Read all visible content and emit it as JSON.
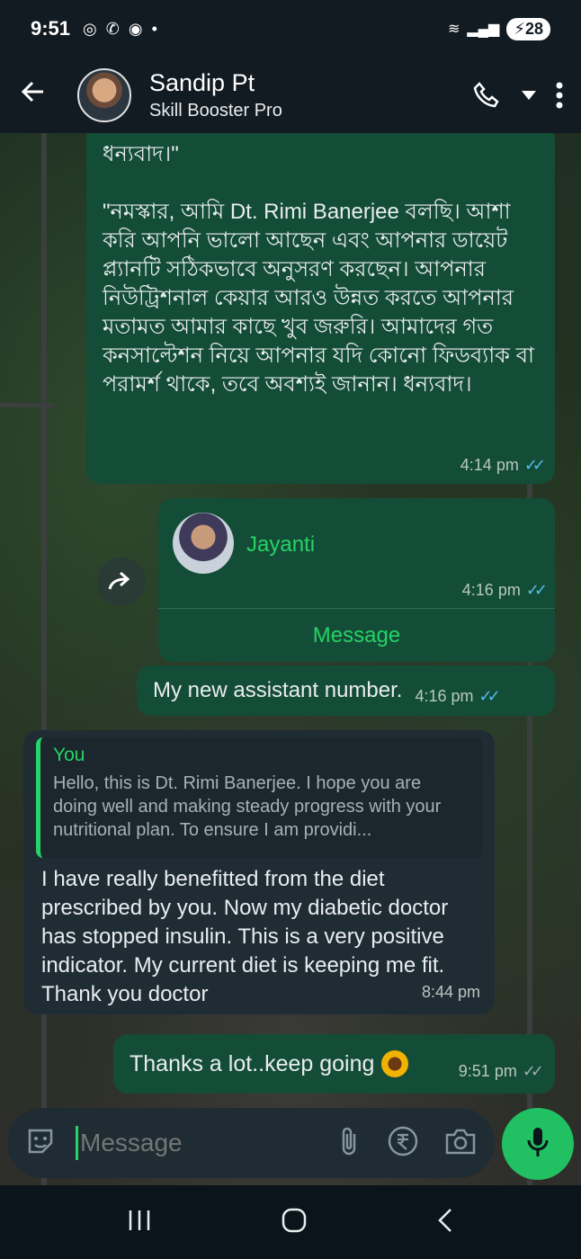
{
  "status_bar": {
    "time": "9:51",
    "battery": "28"
  },
  "header": {
    "contact_name": "Sandip Pt",
    "contact_status": "Skill Booster Pro"
  },
  "messages": [
    {
      "text": "ধন্যবাদ।\"\n\n\"নমস্কার, আমি Dt. Rimi Banerjee বলছি। আশা করি আপনি ভালো আছেন এবং আপনার ডায়েট প্ল্যানটি সঠিকভাবে অনুসরণ করছেন। আপনার নিউট্রিশনাল কেয়ার আরও উন্নত করতে আপনার মতামত আমার কাছে খুব জরুরি। আমাদের গত কনসাল্টেশন নিয়ে আপনার যদি কোনো ফিডব্যাক বা পরামর্শ থাকে, তবে অবশ্যই জানান। ধন্যবাদ।",
      "time": "4:14 pm"
    },
    {
      "contact_card_name": "Jayanti",
      "time": "4:16 pm",
      "button_label": "Message"
    },
    {
      "text": "My new assistant number.",
      "time": "4:16 pm"
    },
    {
      "quote_author": "You",
      "quote_text": "Hello, this is Dt. Rimi Banerjee. I hope you are doing well and making steady progress with your nutritional plan. To ensure I am providi...",
      "text": "I have really benefitted from the diet prescribed by you. Now my diabetic doctor has stopped insulin. This is a very positive indicator. My current diet is keeping me fit. Thank you doctor",
      "time": "8:44 pm"
    },
    {
      "text": "Thanks a lot..keep going",
      "time": "9:51 pm"
    }
  ],
  "input": {
    "placeholder": "Message"
  },
  "icons": [
    "back-arrow-icon",
    "phone-icon",
    "dropdown-icon",
    "more-vert-icon",
    "forward-icon",
    "sticker-icon",
    "attach-icon",
    "rupee-icon",
    "camera-icon",
    "mic-icon",
    "sunflower-emoji",
    "recents-icon",
    "home-icon",
    "nav-back-icon"
  ],
  "colors": {
    "header": "#121b22",
    "outgoing": "#144d37",
    "incoming": "#1f2c34",
    "accent": "#25d366",
    "read_tick": "#53bdeb"
  }
}
